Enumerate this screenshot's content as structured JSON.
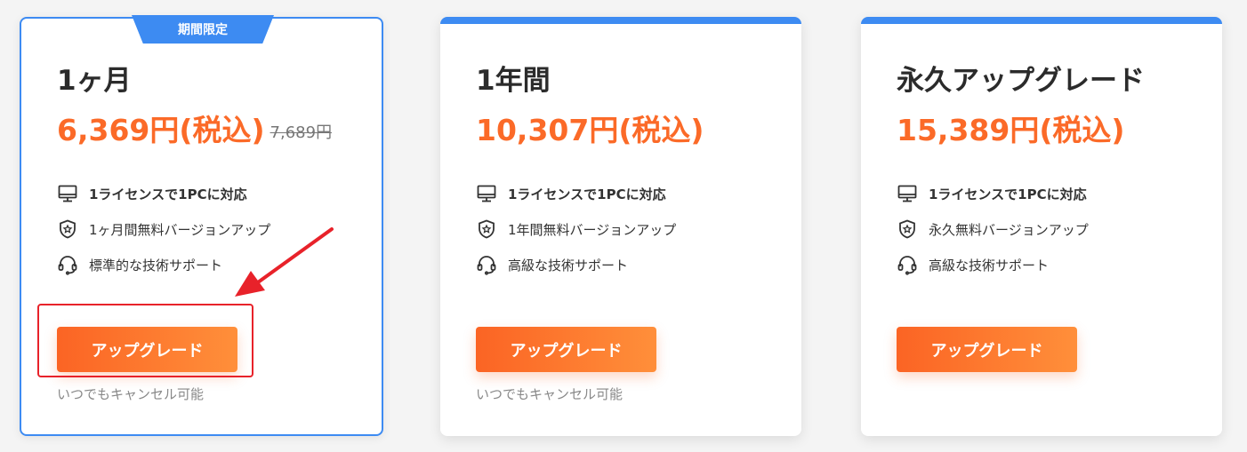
{
  "plans": [
    {
      "badge": "期間限定",
      "title": "1ヶ月",
      "price": "6,369円(税込)",
      "old_price": "7,689円",
      "features": [
        {
          "icon": "monitor-icon",
          "text": "1ライセンスで1PCに対応"
        },
        {
          "icon": "shield-star-icon",
          "text": "1ヶ月間無料バージョンアップ"
        },
        {
          "icon": "headset-icon",
          "text": "標準的な技術サポート"
        }
      ],
      "button_label": "アップグレード",
      "cancel_note": "いつでもキャンセル可能"
    },
    {
      "title": "1年間",
      "price": "10,307円(税込)",
      "features": [
        {
          "icon": "monitor-icon",
          "text": "1ライセンスで1PCに対応"
        },
        {
          "icon": "shield-star-icon",
          "text": "1年間無料バージョンアップ"
        },
        {
          "icon": "headset-icon",
          "text": "高級な技術サポート"
        }
      ],
      "button_label": "アップグレード",
      "cancel_note": "いつでもキャンセル可能"
    },
    {
      "title": "永久アップグレード",
      "price": "15,389円(税込)",
      "features": [
        {
          "icon": "monitor-icon",
          "text": "1ライセンスで1PCに対応"
        },
        {
          "icon": "shield-star-icon",
          "text": "永久無料バージョンアップ"
        },
        {
          "icon": "headset-icon",
          "text": "高級な技術サポート"
        }
      ],
      "button_label": "アップグレード"
    }
  ],
  "colors": {
    "accent_blue": "#3d8bf2",
    "price_orange": "#fb6a28",
    "annotation_red": "#e8222a"
  }
}
